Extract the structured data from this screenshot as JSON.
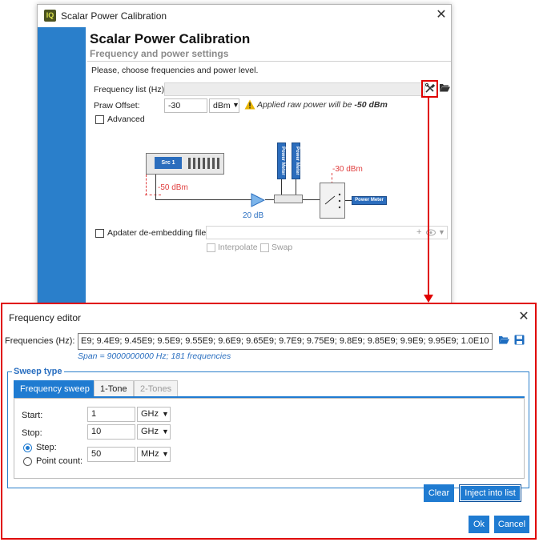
{
  "calibration_window": {
    "title": "Scalar Power Calibration",
    "app_icon_text": "IQ",
    "close_glyph": "✕",
    "header_title": "Scalar Power Calibration",
    "header_subtitle": "Frequency and power settings",
    "instructions": "Please, choose frequencies and power level.",
    "frequency_list_label": "Frequency list (Hz):",
    "frequency_list_value": "",
    "raw_offset_label": "Praw Offset:",
    "raw_offset_value": "-30",
    "raw_offset_unit": "dBm",
    "warning_prefix": "Applied raw power will be ",
    "warning_value": "-50 dBm",
    "advanced_label": "Advanced",
    "deembedding_label": "Apdater de-embedding file:",
    "deembedding_value": "",
    "interpolate_label": "Interpolate",
    "swap_label": "Swap",
    "diagram": {
      "source_label": "Src 1",
      "source_power": "-50 dBm",
      "amp_gain": "20 dB",
      "meter_power": "-30 dBm",
      "power_meter_label": "Power Meter"
    },
    "icons": {
      "tools": "tools-icon",
      "open_folder": "folder-open-icon",
      "warning": "warning-icon"
    }
  },
  "frequency_editor": {
    "title": "Frequency editor",
    "close_glyph": "✕",
    "frequencies_label": "Frequencies (Hz):",
    "frequencies_value": "E9; 9.4E9; 9.45E9; 9.5E9; 9.55E9; 9.6E9; 9.65E9; 9.7E9; 9.75E9; 9.8E9; 9.85E9; 9.9E9; 9.95E9; 1.0E10",
    "span_text": "Span = 9000000000 Hz; 181 frequencies",
    "sweep_type_label": "Sweep type",
    "tabs": [
      {
        "label": "Frequency sweep",
        "active": true
      },
      {
        "label": "1-Tone",
        "active": false
      },
      {
        "label": "2-Tones",
        "active": false,
        "disabled": true
      }
    ],
    "start_label": "Start:",
    "start_value": "1",
    "start_unit": "GHz",
    "stop_label": "Stop:",
    "stop_value": "10",
    "stop_unit": "GHz",
    "step_label": "Step:",
    "point_count_label": "Point count:",
    "step_value": "50",
    "step_unit": "MHz",
    "step_selected": true,
    "clear_button": "Clear",
    "inject_button": "Inject into list",
    "ok_button": "Ok",
    "cancel_button": "Cancel"
  },
  "colors": {
    "accent": "#1f7bd1",
    "highlight": "#e00000",
    "warning": "#e0a000"
  }
}
